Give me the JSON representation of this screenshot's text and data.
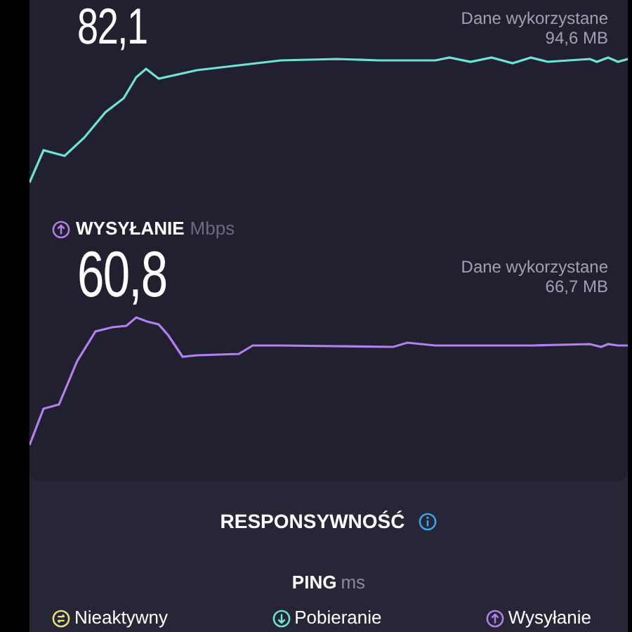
{
  "download": {
    "value": "82,1",
    "data_label": "Dane wykorzystane",
    "data_amount": "94,6 MB"
  },
  "upload": {
    "title": "WYSYŁANIE",
    "unit": "Mbps",
    "value": "60,8",
    "data_label": "Dane wykorzystane",
    "data_amount": "66,7 MB"
  },
  "responsiveness": {
    "title": "RESPONSYWNOŚĆ",
    "ping_title": "PING",
    "ping_unit": "ms",
    "legend": [
      {
        "kind": "idle",
        "label": "Nieaktywny",
        "color": "#e8e37a"
      },
      {
        "kind": "download",
        "label": "Pobieranie",
        "color": "#6fe3d6"
      },
      {
        "kind": "upload",
        "label": "Wysyłanie",
        "color": "#b47ff0"
      }
    ]
  }
}
